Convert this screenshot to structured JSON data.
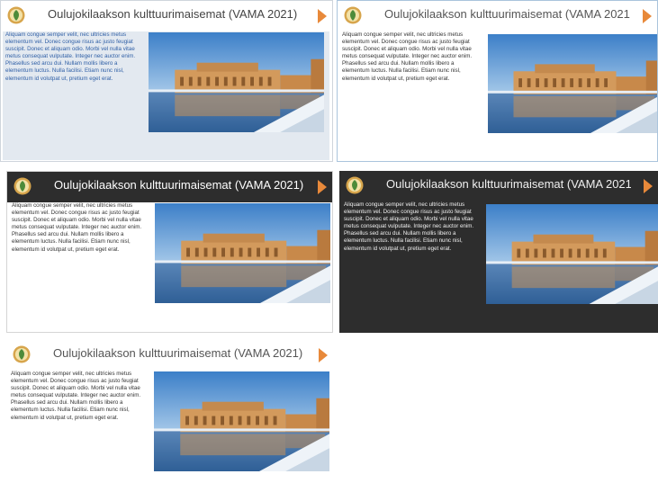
{
  "cards": {
    "title": "Oulujokilaakson kulttuurimaisemat (VAMA 2021)",
    "body": "Aliquam congue semper velit, nec ultricies metus elementum vel. Donec congue risus ac justo feugiat suscipit. Donec et aliquam odio. Morbi vel nulla vitae metus consequat vulputate. Integer nec auctor enim. Phasellus sed arcu dui. Nullam mollis libero a elementum luctus. Nulla facilisi. Etiam nunc nisl, elementum id volutpat ut, pretium eget erat."
  },
  "colors": {
    "accent_arrow": "#e8893a",
    "dark_header": "#2d2d2d",
    "link_blue": "#2f5fa6",
    "light_blue_bg": "#e3e9f0"
  },
  "icons": {
    "logo": "leaf-emblem-icon",
    "next": "next-arrow-icon"
  }
}
